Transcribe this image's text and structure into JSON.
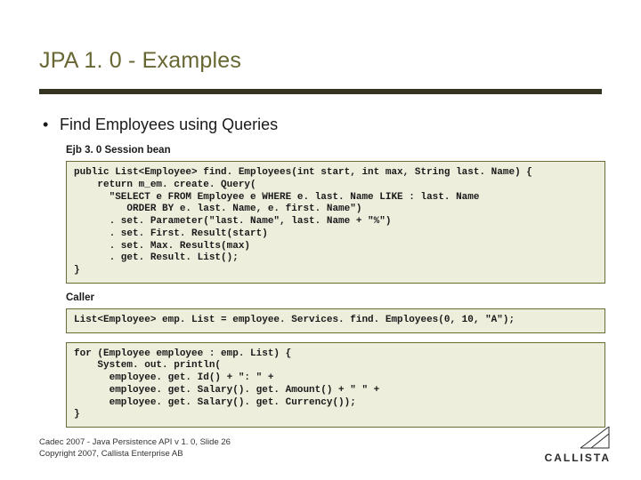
{
  "title": "JPA 1. 0 - Examples",
  "bullet1": "Find Employees using Queries",
  "labels": {
    "session": "Ejb 3. 0 Session bean",
    "caller": "Caller"
  },
  "code": {
    "session": "public List<Employee> find. Employees(int start, int max, String last. Name) {\n    return m_em. create. Query(\n      \"SELECT e FROM Employee e WHERE e. last. Name LIKE : last. Name\n         ORDER BY e. last. Name, e. first. Name\")\n      . set. Parameter(\"last. Name\", last. Name + \"%\")\n      . set. First. Result(start)\n      . set. Max. Results(max)\n      . get. Result. List();\n}",
    "caller1": "List<Employee> emp. List = employee. Services. find. Employees(0, 10, \"A\");",
    "caller2": "for (Employee employee : emp. List) {\n    System. out. println(\n      employee. get. Id() + \": \" +\n      employee. get. Salary(). get. Amount() + \" \" +\n      employee. get. Salary(). get. Currency());\n}"
  },
  "footer": {
    "line1": "Cadec 2007 - Java Persistence API v 1. 0, Slide 26",
    "line2": "Copyright 2007, Callista Enterprise AB"
  },
  "logo_text": "CALLISTA"
}
